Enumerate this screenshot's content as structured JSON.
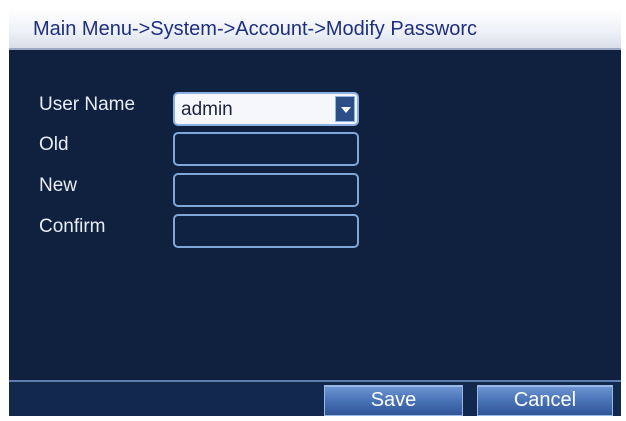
{
  "header": {
    "breadcrumb": "Main Menu->System->Account->Modify Passworc"
  },
  "form": {
    "user_name": {
      "label": "User Name",
      "value": "admin"
    },
    "old": {
      "label": "Old",
      "value": ""
    },
    "new": {
      "label": "New",
      "value": ""
    },
    "confirm": {
      "label": "Confirm",
      "value": ""
    }
  },
  "footer": {
    "save_label": "Save",
    "cancel_label": "Cancel"
  },
  "icons": {
    "dropdown": "chevron-down-icon"
  },
  "colors": {
    "background": "#0f1f3a",
    "title_text": "#1d2f7f",
    "field_border": "#7fa7d8",
    "button_top": "#6f96d3",
    "button_bottom": "#2f5595"
  }
}
